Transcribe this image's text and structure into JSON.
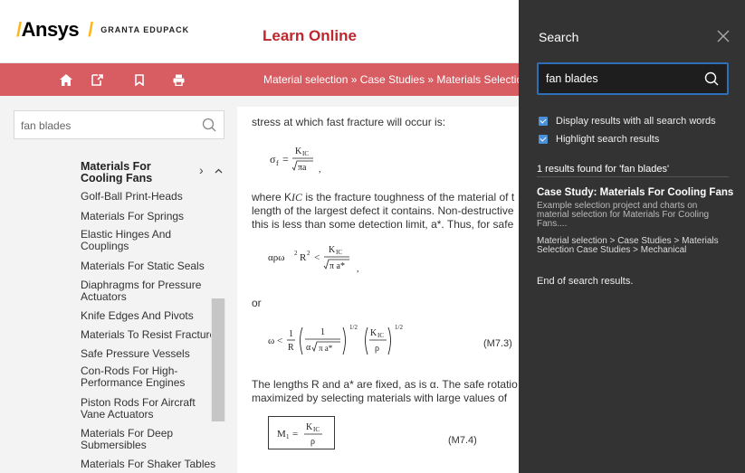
{
  "header": {
    "brand_name": "Ansys",
    "brand_sub": "GRANTA EDUPACK",
    "section_title": "Learn Online"
  },
  "toolbar": {
    "icons": [
      "home-icon",
      "export-icon",
      "bookmark-icon",
      "print-icon"
    ],
    "breadcrumb": "Material selection » Case Studies » Materials Selection"
  },
  "sidebar": {
    "search_value": "fan blades",
    "items": [
      {
        "label": "Materials For Cooling Fans",
        "active": true
      },
      {
        "label": "Golf-Ball Print-Heads"
      },
      {
        "label": "Materials For Springs"
      },
      {
        "label": "Elastic Hinges And Couplings"
      },
      {
        "label": "Materials For Static Seals"
      },
      {
        "label": "Diaphragms for Pressure Actuators"
      },
      {
        "label": "Knife Edges And Pivots"
      },
      {
        "label": "Materials To Resist Fracture"
      },
      {
        "label": "Safe Pressure Vessels"
      },
      {
        "label": "Con-Rods For High-Performance Engines"
      },
      {
        "label": "Piston Rods For Aircraft Vane Actuators"
      },
      {
        "label": "Materials For Deep Submersibles"
      },
      {
        "label": "Materials For Shaker Tables"
      }
    ]
  },
  "content": {
    "line_top_cut": "stress at which fast fracture will occur is:",
    "para1_line1": "where K",
    "para1_line1_sub": "IC",
    "para1_line1_rest": " is the fracture toughness of the material of t",
    "para1_line2": "length of the largest defect it contains. Non-destructive",
    "para1_line3": "this is less than some detection limit, a*. Thus, for safe",
    "or": "or",
    "eq1_label": "(M7.3)",
    "para2_line1": "The lengths R and a* are fixed, as is α. The safe rotatio",
    "para2_line2": "maximized by selecting materials with large values of",
    "eq2_label": "(M7.4)"
  },
  "search_panel": {
    "title": "Search",
    "query": "fan blades",
    "opt_all_words": "Display results with all search words",
    "opt_highlight": "Highlight search results",
    "count_text": "1 results found for 'fan blades'",
    "result_title": "Case Study: Materials For Cooling Fans",
    "result_desc": "Example selection project and charts on material selection for Materials For Cooling Fans....",
    "result_path": "Material selection > Case Studies > Materials Selection Case Studies > Mechanical",
    "end_text": "End of search results."
  },
  "colors": {
    "brand_red": "#c0262d",
    "toolbar": "#d75d62",
    "accent_yellow": "#ffb71b",
    "panel_bg": "#333333",
    "focus_blue": "#2f6fb8"
  }
}
